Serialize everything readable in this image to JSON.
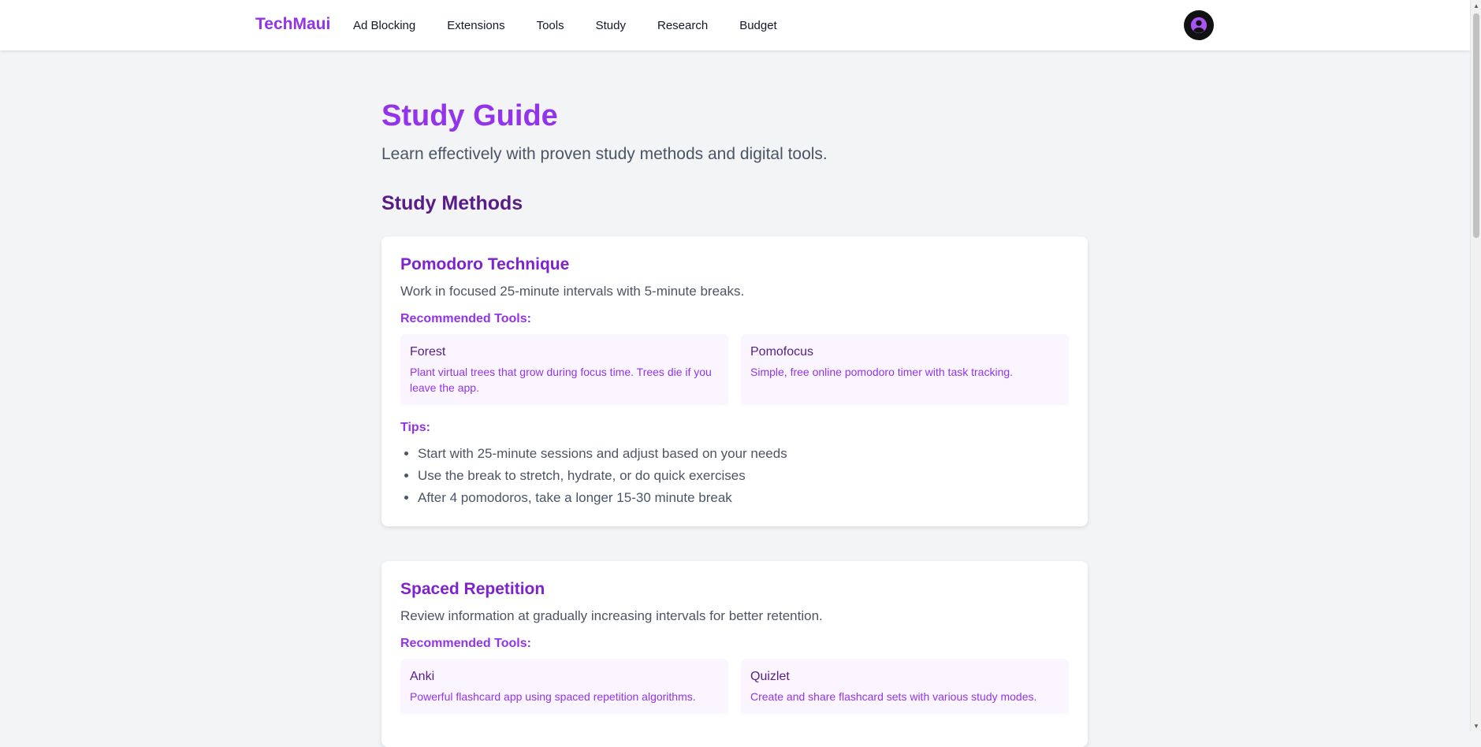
{
  "nav": {
    "brand": "TechMaui",
    "links": [
      "Ad Blocking",
      "Extensions",
      "Tools",
      "Study",
      "Research",
      "Budget"
    ],
    "avatar_icon": "user-circle-icon"
  },
  "page": {
    "title": "Study Guide",
    "subtitle": "Learn effectively with proven study methods and digital tools.",
    "section_title": "Study Methods"
  },
  "methods": [
    {
      "title": "Pomodoro Technique",
      "description": "Work in focused 25-minute intervals with 5-minute breaks.",
      "tools_label": "Recommended Tools:",
      "tools": [
        {
          "name": "Forest",
          "description": "Plant virtual trees that grow during focus time. Trees die if you leave the app."
        },
        {
          "name": "Pomofocus",
          "description": "Simple, free online pomodoro timer with task tracking."
        }
      ],
      "tips_label": "Tips:",
      "tips": [
        "Start with 25-minute sessions and adjust based on your needs",
        "Use the break to stretch, hydrate, or do quick exercises",
        "After 4 pomodoros, take a longer 15-30 minute break"
      ]
    },
    {
      "title": "Spaced Repetition",
      "description": "Review information at gradually increasing intervals for better retention.",
      "tools_label": "Recommended Tools:",
      "tools": [
        {
          "name": "Anki",
          "description": "Powerful flashcard app using spaced repetition algorithms."
        },
        {
          "name": "Quizlet",
          "description": "Create and share flashcard sets with various study modes."
        }
      ]
    }
  ],
  "colors": {
    "accent": "#9333ea",
    "heading_dark": "#581c87",
    "tool_bg": "#faf5ff",
    "page_bg": "#f3f4f6"
  }
}
